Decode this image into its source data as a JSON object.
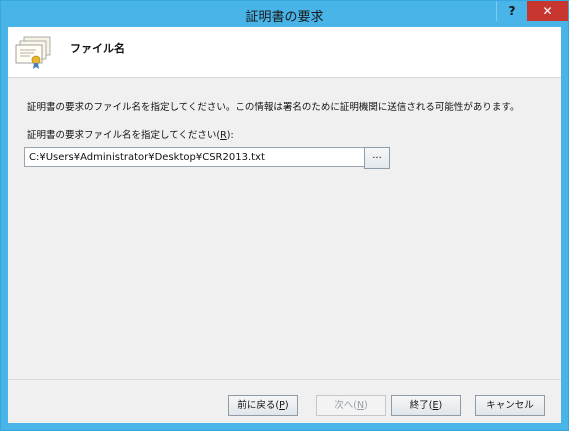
{
  "window": {
    "title": "証明書の要求",
    "help_label": "?",
    "close_label": "✕"
  },
  "header": {
    "title": "ファイル名",
    "icon": "certificate-icon"
  },
  "body": {
    "description": "証明書の要求のファイル名を指定してください。この情報は署名のために証明機関に送信される可能性があります。",
    "field_label_prefix": "証明書の要求ファイル名を指定してください(",
    "field_label_accel": "R",
    "field_label_suffix": "):",
    "file_path": "C:¥Users¥Administrator¥Desktop¥CSR2013.txt",
    "browse_label": "..."
  },
  "buttons": {
    "back": {
      "prefix": "前に戻る(",
      "accel": "P",
      "suffix": ")"
    },
    "next": {
      "prefix": "次へ(",
      "accel": "N",
      "suffix": ")",
      "disabled": true
    },
    "finish": {
      "prefix": "終了(",
      "accel": "E",
      "suffix": ")"
    },
    "cancel": {
      "label": "キャンセル"
    }
  },
  "colors": {
    "titlebar": "#48b4e8",
    "close": "#c7372f",
    "client": "#f0f0f0"
  }
}
